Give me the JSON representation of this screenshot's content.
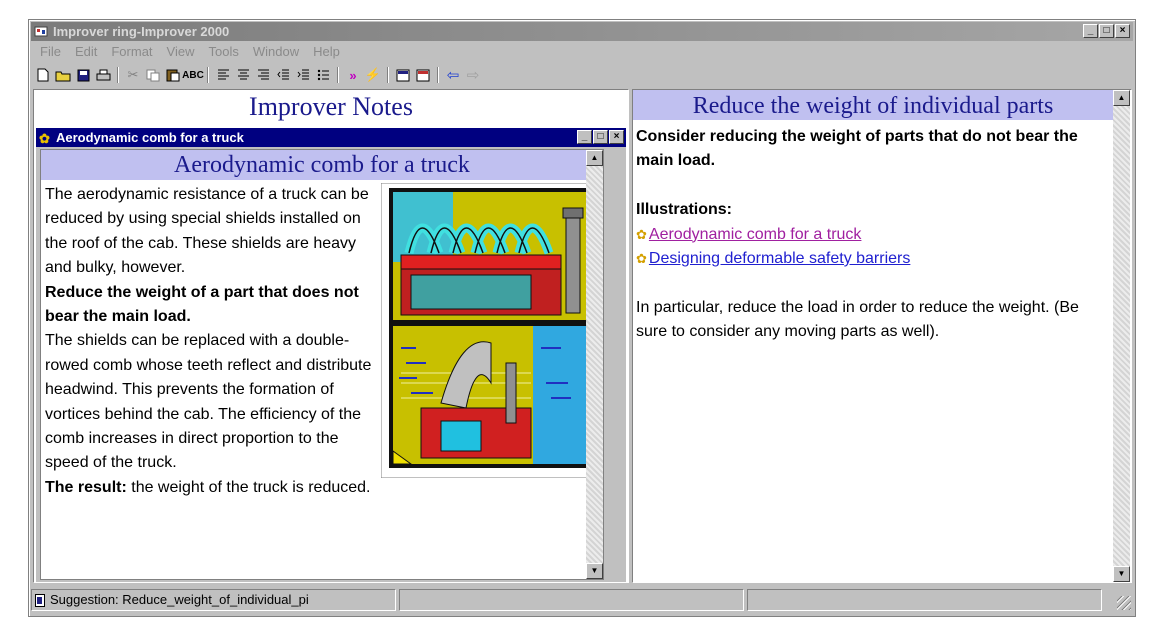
{
  "window": {
    "title": "Improver ring-Improver 2000"
  },
  "menu": [
    "File",
    "Edit",
    "Format",
    "View",
    "Tools",
    "Window",
    "Help"
  ],
  "toolbar": {
    "buttons": [
      "new-icon",
      "open-icon",
      "save-icon",
      "print-icon",
      "cut-icon",
      "copy-icon",
      "paste-icon",
      "spellcheck-icon",
      "align-left-icon",
      "align-center-icon",
      "align-right-icon",
      "decrease-indent-icon",
      "increase-indent-icon",
      "bullets-icon",
      "next-icon",
      "jump-icon",
      "note-icon",
      "view-note-icon",
      "back-icon",
      "forward-icon"
    ]
  },
  "left": {
    "notes_title": "Improver Notes",
    "child_title": "Aerodynamic comb for a truck",
    "heading": "Aerodynamic comb for a truck",
    "para1": "The aerodynamic resistance of a truck can be reduced by using special shields installed on the roof of the cab. These shields are heavy and bulky, however.",
    "para2_bold": "Reduce the weight of a part that does not bear the main load.",
    "para3": "The shields can be replaced with a double-rowed comb whose teeth reflect and distribute headwind. This prevents the formation of vortices behind the cab. The efficiency of the comb increases in direct proportion to the speed of the truck.",
    "result_label": "The result:",
    "result_text": " the weight of the truck is reduced."
  },
  "right": {
    "heading": "Reduce the weight of individual parts",
    "intro": "Consider reducing the weight of parts that do not bear the main load.",
    "illustrations_label": "Illustrations:",
    "links": [
      {
        "label": "Aerodynamic comb for a truck",
        "color": "#a020a0"
      },
      {
        "label": "Designing deformable safety barriers",
        "color": "#2020d0"
      }
    ],
    "paragraph": "In particular, reduce the load in order to reduce the weight. (Be sure to consider any moving parts as well)."
  },
  "status": {
    "suggestion": "Suggestion: Reduce_weight_of_individual_pi"
  }
}
